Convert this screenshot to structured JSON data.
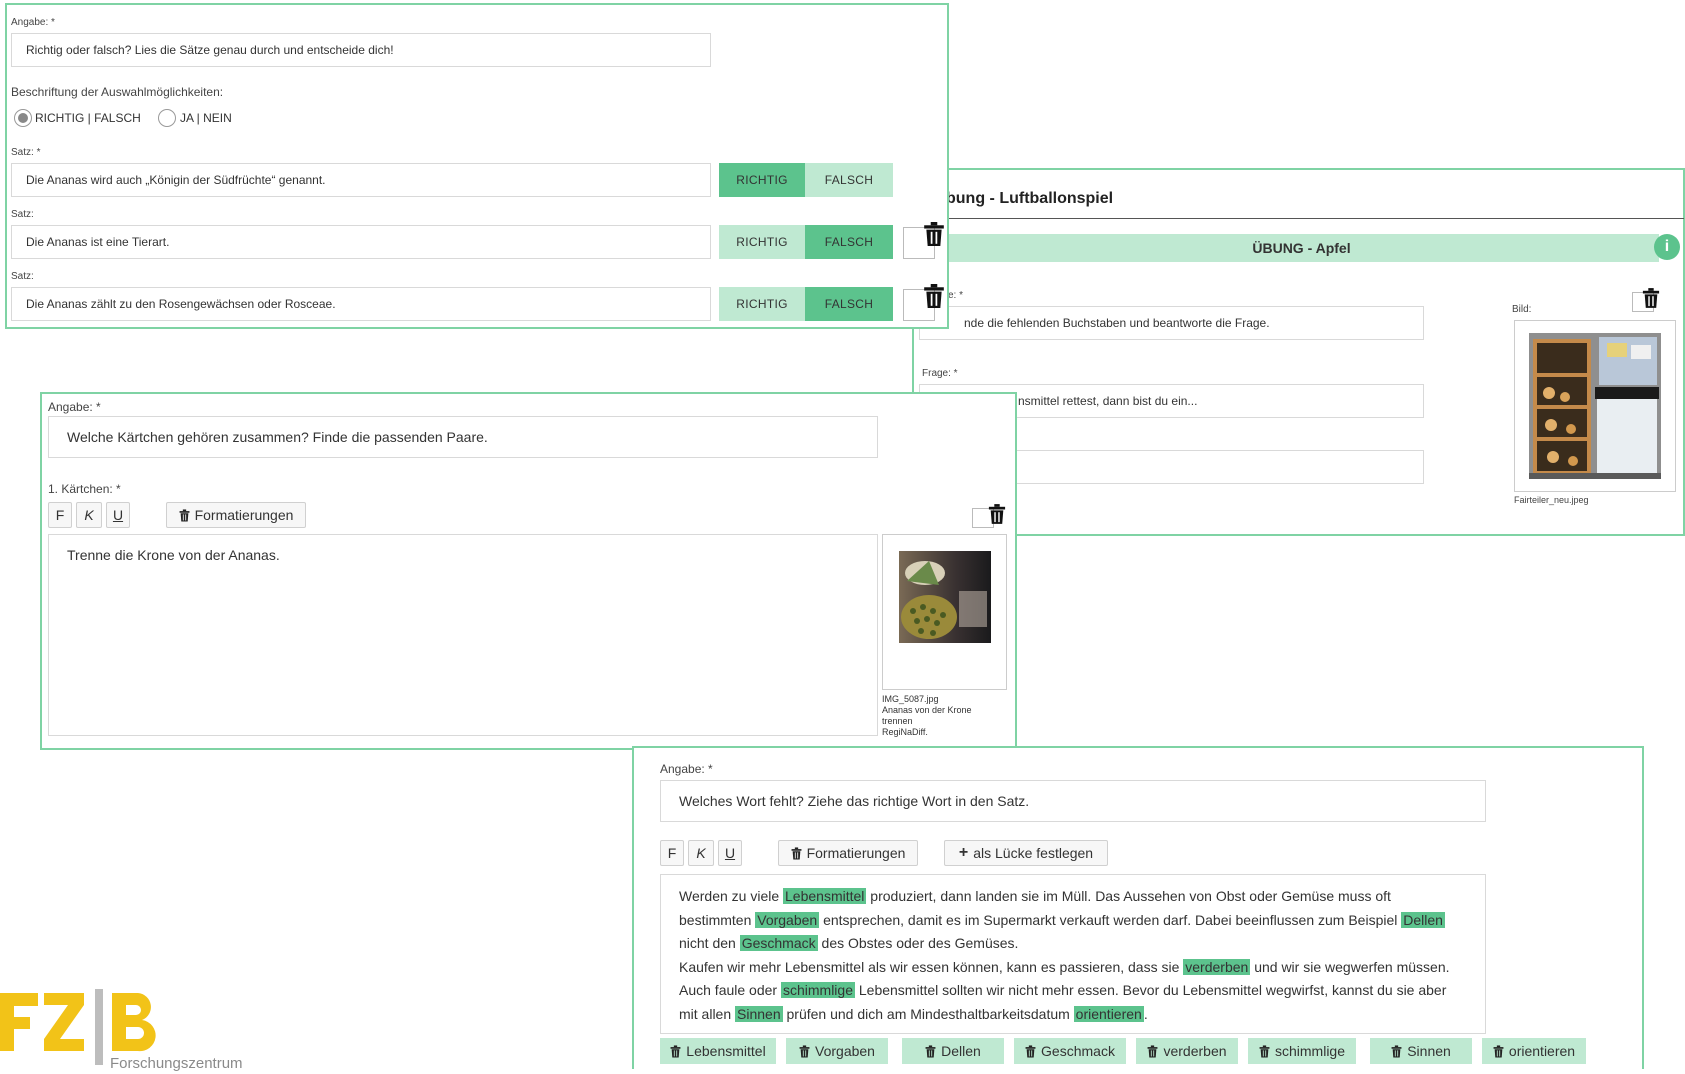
{
  "tf_panel": {
    "angabe_label": "Angabe: *",
    "angabe_value": "Richtig oder falsch? Lies die Sätze genau durch und entscheide dich!",
    "options_label": "Beschriftung der Auswahlmöglichkeiten:",
    "option1": "RICHTIG | FALSCH",
    "option2": "JA | NEIN",
    "rows": [
      {
        "label": "Satz: *",
        "text": "Die Ananas wird auch „Königin der Südfrüchte“ genannt.",
        "selected": "richtig"
      },
      {
        "label": "Satz:",
        "text": "Die Ananas ist eine Tierart.",
        "selected": "falsch"
      },
      {
        "label": "Satz:",
        "text": "Die Ananas zählt zu den Rosengewächsen oder Rosceae.",
        "selected": "falsch"
      }
    ],
    "richtig": "RICHTIG",
    "falsch": "FALSCH"
  },
  "balloon_panel": {
    "title_fragment": "bung - Luftballonspiel",
    "banner": "ÜBUNG - Apfel",
    "label1_fragment": "e: *",
    "value1_fragment": "nde die fehlenden Buchstaben und beantworte die Frage.",
    "frage_label": "Frage: *",
    "frage_fragment": "nsmittel rettest, dann bist du ein...",
    "bild_label": "Bild:",
    "image_caption": "Fairteiler_neu.jpeg"
  },
  "pairs_panel": {
    "angabe_label": "Angabe: *",
    "angabe_value": "Welche Kärtchen gehören zusammen? Finde die passenden Paare.",
    "card_label": "1. Kärtchen: *",
    "bold": "F",
    "italic": "K",
    "underline": "U",
    "formatierungen": "Formatierungen",
    "card_text": "Trenne die Krone von der Ananas.",
    "image_caption": [
      "IMG_5087.jpg",
      "Ananas von der Krone",
      "trennen",
      "RegiNaDiff."
    ]
  },
  "gap_panel": {
    "angabe_label": "Angabe: *",
    "angabe_value": "Welches Wort fehlt? Ziehe das richtige Wort in den Satz.",
    "bold": "F",
    "italic": "K",
    "underline": "U",
    "formatierungen": "Formatierungen",
    "luecke": "als Lücke festlegen",
    "text": {
      "p1": "Werden zu viele ",
      "g1": "Lebensmittel",
      "p2": " produziert, dann landen sie im Müll. Das Aussehen von Obst oder Gemüse muss oft bestimmten ",
      "g2": "Vorgaben",
      "p3": " entsprechen, damit es im Supermarkt verkauft werden darf. Dabei beeinflussen zum Beispiel ",
      "g3": "Dellen",
      "p4": " nicht den ",
      "g4": "Geschmack",
      "p5": " des Obstes oder des Gemüses.",
      "p6": "Kaufen wir mehr Lebensmittel als wir essen können, kann es passieren, dass sie ",
      "g5": "verderben",
      "p7": " und wir sie wegwerfen müssen. Auch faule oder ",
      "g6": "schimmlige",
      "p8": " Lebensmittel sollten wir nicht mehr essen. Bevor du Lebensmittel wegwirfst, kannst du sie aber mit allen ",
      "g7": "Sinnen",
      "p9": " prüfen und dich am Mindesthaltbarkeitsdatum ",
      "g8": "orientieren",
      "p10": "."
    },
    "chips": [
      "Lebensmittel",
      "Vorgaben",
      "Dellen",
      "Geschmack",
      "verderben",
      "schimmlige",
      "Sinnen",
      "orientieren"
    ]
  },
  "logo": {
    "text": "FZ|B",
    "subtitle": "Forschungszentrum"
  },
  "colors": {
    "accent": "#5cc38d",
    "accent_light": "#bfe9d2",
    "border": "#7fd3a4",
    "logo_yellow": "#f2c318",
    "logo_gray": "#9a9a9a"
  }
}
